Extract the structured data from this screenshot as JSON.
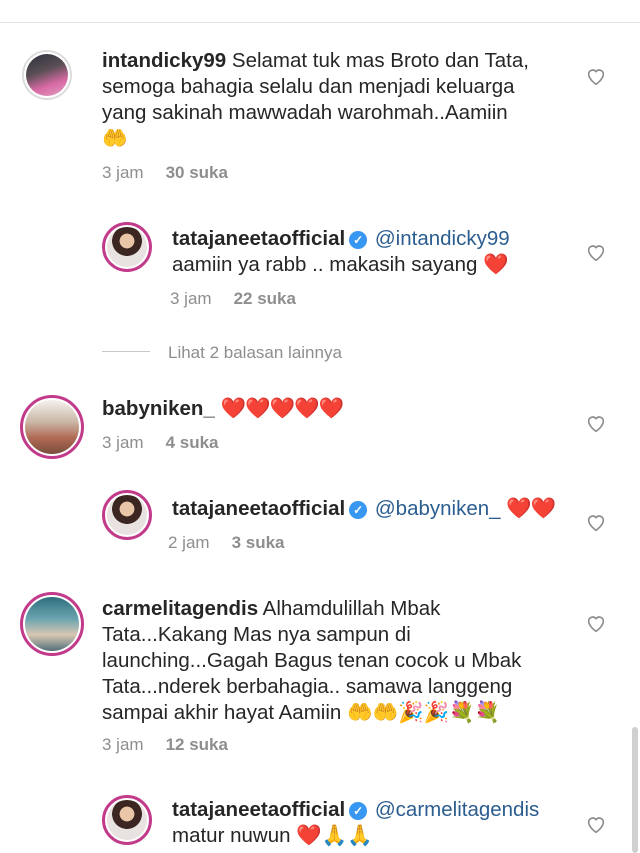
{
  "comments": [
    {
      "username": "intandicky99",
      "text_lines": [
        "Selamat tuk mas Broto dan Tata,",
        "semoga bahagia selalu dan menjadi keluarga",
        "yang sakinah mawwadah warohmah..Aamiin",
        "🤲"
      ],
      "time": "3 jam",
      "likes": "30 suka"
    },
    {
      "username": "tatajaneetaofficial",
      "mention": "@intandicky99",
      "text_lines": [
        "aamiin ya rabb .. makasih sayang ❤️"
      ],
      "time": "3 jam",
      "likes": "22 suka"
    },
    {
      "username": "babyniken_",
      "text_lines": [
        "❤️❤️❤️❤️❤️"
      ],
      "time": "3 jam",
      "likes": "4 suka"
    },
    {
      "username": "tatajaneetaofficial",
      "mention": "@babyniken_",
      "text_lines": [
        "❤️❤️"
      ],
      "time": "2 jam",
      "likes": "3 suka"
    },
    {
      "username": "carmelitagendis",
      "text_lines": [
        "Alhamdulillah Mbak",
        "Tata...Kakang Mas nya sampun di",
        "launching...Gagah Bagus tenan cocok u Mbak",
        "Tata...nderek berbahagia.. samawa langgeng",
        "sampai akhir hayat Aamiin 🤲🤲🎉🎉💐💐"
      ],
      "time": "3 jam",
      "likes": "12 suka"
    },
    {
      "username": "tatajaneetaofficial",
      "mention": "@carmelitagendis",
      "text_lines": [
        "matur nuwun ❤️🙏🙏"
      ]
    }
  ],
  "view_more_replies": "Lihat 2 balasan lainnya",
  "icons": {
    "like": "heart-outline-icon",
    "verified": "verified-badge-icon"
  },
  "colors": {
    "mention": "#2b5d8f",
    "verified": "#3897f0",
    "heart": "#e0242f",
    "muted": "#8e8e8e"
  }
}
